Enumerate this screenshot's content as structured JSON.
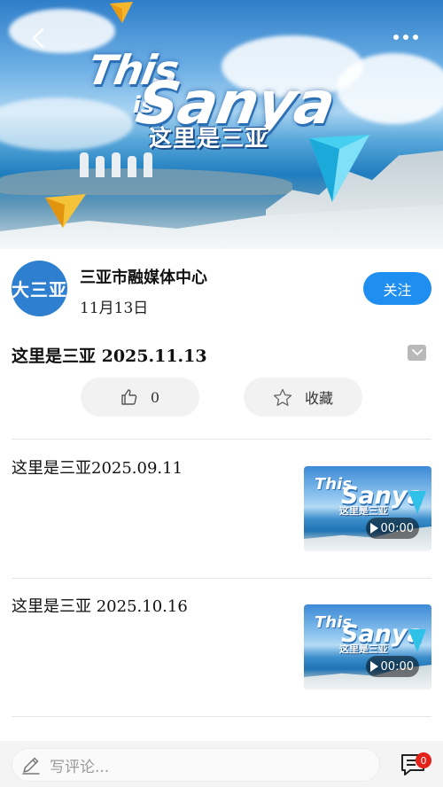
{
  "hero": {
    "title_line1": "This",
    "title_line2": "Sanya",
    "title_small": "is",
    "subtitle_cn": "这里是三亚"
  },
  "author": {
    "avatar_text": "大三亚",
    "name": "三亚市融媒体中心",
    "date": "11月13日",
    "follow_label": "关注"
  },
  "article": {
    "title": "这里是三亚 2025.11.13"
  },
  "actions": {
    "like_count": "0",
    "favorite_label": "收藏"
  },
  "related": [
    {
      "title": "这里是三亚2025.09.11",
      "duration": "00:00",
      "thumb_t1": "This",
      "thumb_t2": "Sanya",
      "thumb_t3": "这里是三亚"
    },
    {
      "title": "这里是三亚 2025.10.16",
      "duration": "00:00",
      "thumb_t1": "This",
      "thumb_t2": "Sanya",
      "thumb_t3": "这里是三亚"
    }
  ],
  "comment": {
    "placeholder": "写评论...",
    "badge_count": "0"
  },
  "colors": {
    "accent": "#1e8ef0",
    "badge": "#e6211a"
  }
}
